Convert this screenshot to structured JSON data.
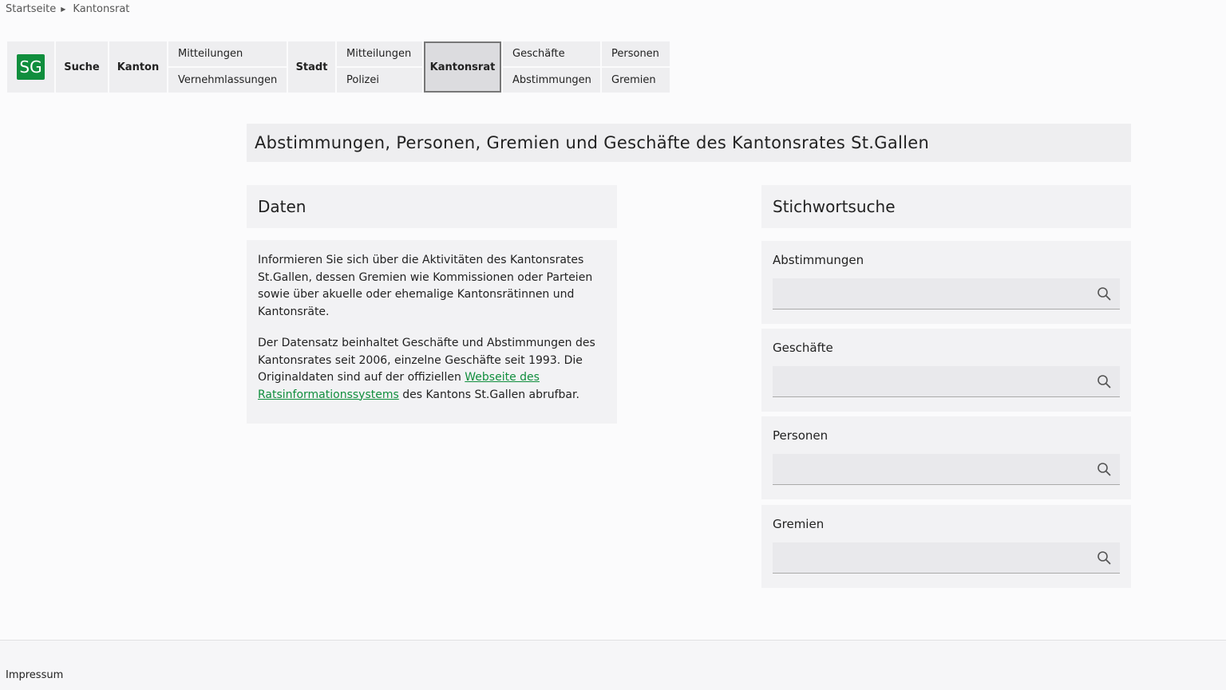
{
  "breadcrumb": {
    "home": "Startseite",
    "current": "Kantonsrat"
  },
  "nav": {
    "logo": "SG",
    "suche": "Suche",
    "kanton": "Kanton",
    "kanton_sub1": "Mitteilungen",
    "kanton_sub2": "Vernehmlassungen",
    "stadt": "Stadt",
    "stadt_sub1": "Mitteilungen",
    "stadt_sub2": "Polizei",
    "kantonsrat": "Kantonsrat",
    "kr_sub1": "Geschäfte",
    "kr_sub2": "Abstimmungen",
    "kr_sub3": "Personen",
    "kr_sub4": "Gremien",
    "logo_color": "#108e3d"
  },
  "headline": "Abstimmungen, Personen, Gremien und Geschäfte des Kantonsrates St.Gallen",
  "daten": {
    "title": "Daten",
    "p1": "Informieren Sie sich über die Aktivitäten des Kantonsrates St.Gallen, dessen Gremien wie Kommissionen oder Parteien sowie über akuelle oder ehemalige Kantonsrätinnen und Kantonsräte.",
    "p2_before": "Der Datensatz beinhaltet Geschäfte und Abstimmungen des Kantonsrates seit 2006, einzelne Geschäfte seit 1993. Die Originaldaten sind auf der offiziellen ",
    "p2_link": "Webseite des Ratsinformationssystems",
    "p2_after": " des Kantons St.Gallen abrufbar."
  },
  "search": {
    "title": "Stichwortsuche",
    "abstimmungen": "Abstimmungen",
    "geschaefte": "Geschäfte",
    "personen": "Personen",
    "gremien": "Gremien",
    "icon": "search-icon"
  },
  "footer": {
    "impressum": "Impressum"
  }
}
